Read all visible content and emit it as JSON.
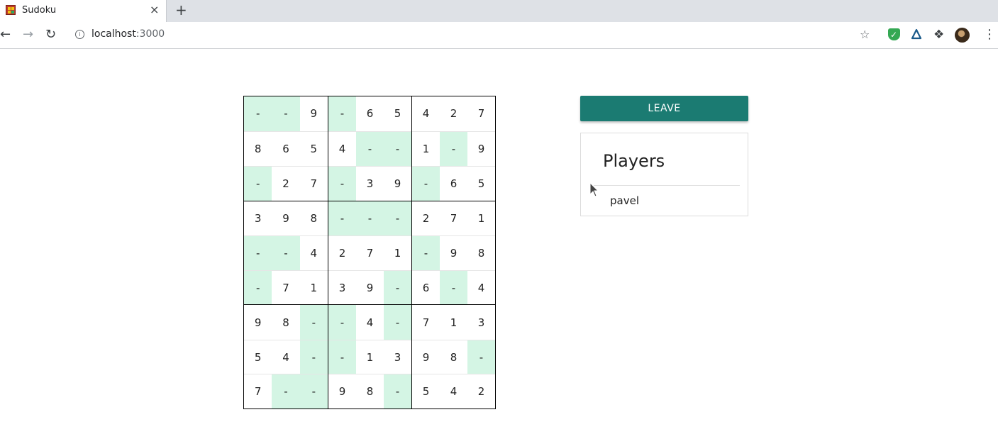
{
  "browser": {
    "tab": {
      "title": "Sudoku",
      "close_icon": "×"
    },
    "new_tab_icon": "+",
    "url_host": "localhost",
    "url_port": ":3000"
  },
  "board": {
    "empty_color": "#d4f5e4",
    "rows": [
      [
        "-",
        "-",
        "9",
        "-",
        "6",
        "5",
        "4",
        "2",
        "7"
      ],
      [
        "8",
        "6",
        "5",
        "4",
        "-",
        "-",
        "1",
        "-",
        "9"
      ],
      [
        "-",
        "2",
        "7",
        "-",
        "3",
        "9",
        "-",
        "6",
        "5"
      ],
      [
        "3",
        "9",
        "8",
        "-",
        "-",
        "-",
        "2",
        "7",
        "1"
      ],
      [
        "-",
        "-",
        "4",
        "2",
        "7",
        "1",
        "-",
        "9",
        "8"
      ],
      [
        "-",
        "7",
        "1",
        "3",
        "9",
        "-",
        "6",
        "-",
        "4"
      ],
      [
        "9",
        "8",
        "-",
        "-",
        "4",
        "-",
        "7",
        "1",
        "3"
      ],
      [
        "5",
        "4",
        "-",
        "-",
        "1",
        "3",
        "9",
        "8",
        "-"
      ],
      [
        "7",
        "-",
        "-",
        "9",
        "8",
        "-",
        "5",
        "4",
        "2"
      ]
    ]
  },
  "panel": {
    "leave_label": "LEAVE",
    "accent_color": "#1b7b72",
    "players_title": "Players",
    "players": [
      "pavel"
    ]
  }
}
